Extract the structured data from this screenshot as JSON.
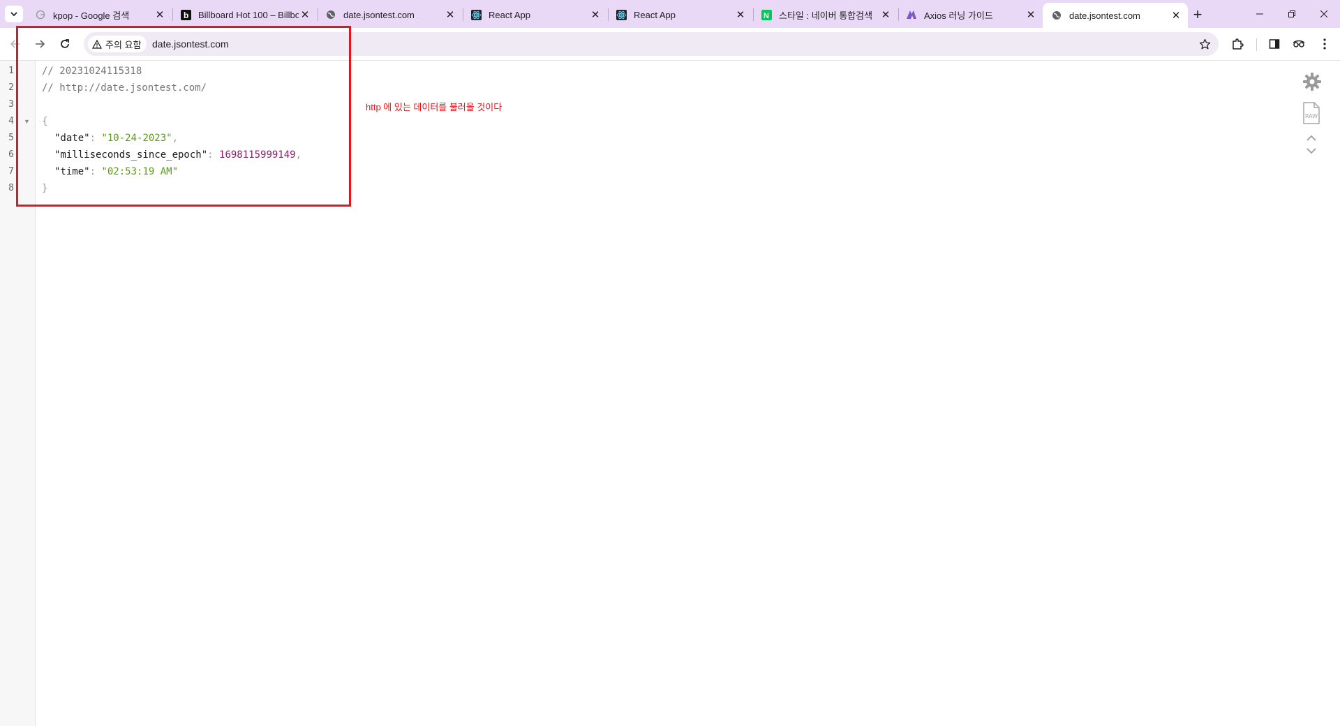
{
  "browser": {
    "tabs": [
      {
        "title": "kpop - Google 검색",
        "favicon": "google-icon"
      },
      {
        "title": "Billboard Hot 100 – Billboard",
        "favicon": "billboard-icon"
      },
      {
        "title": "date.jsontest.com",
        "favicon": "globe-icon"
      },
      {
        "title": "React App",
        "favicon": "react-icon"
      },
      {
        "title": "React App",
        "favicon": "react-icon"
      },
      {
        "title": "스타일 : 네이버 통합검색",
        "favicon": "naver-icon"
      },
      {
        "title": "Axios 러닝 가이드",
        "favicon": "axios-icon"
      },
      {
        "title": "date.jsontest.com",
        "favicon": "globe-icon",
        "active": true
      }
    ],
    "new_tab": "+",
    "security_chip": "주의 요함",
    "url": "date.jsontest.com",
    "colors": {
      "tab_strip": "#e9d9f7",
      "highlight": "#e8141b"
    }
  },
  "viewer": {
    "line_numbers": [
      "1",
      "2",
      "3",
      "4",
      "5",
      "6",
      "7",
      "8"
    ],
    "comment1": "// 20231024115318",
    "comment2": "// http://date.jsontest.com/",
    "open_brace": "{",
    "close_brace": "}",
    "entries": [
      {
        "key": "\"date\"",
        "colon": ": ",
        "value": "\"10-24-2023\"",
        "comma": ","
      },
      {
        "key": "\"milliseconds_since_epoch\"",
        "colon": ": ",
        "value": "1698115999149",
        "comma": ","
      },
      {
        "key": "\"time\"",
        "colon": ": ",
        "value": "\"02:53:19 AM\"",
        "comma": ""
      }
    ],
    "raw_label": "RAW"
  },
  "annotation": "http 에 있는 데이터를 불러올 것이다"
}
